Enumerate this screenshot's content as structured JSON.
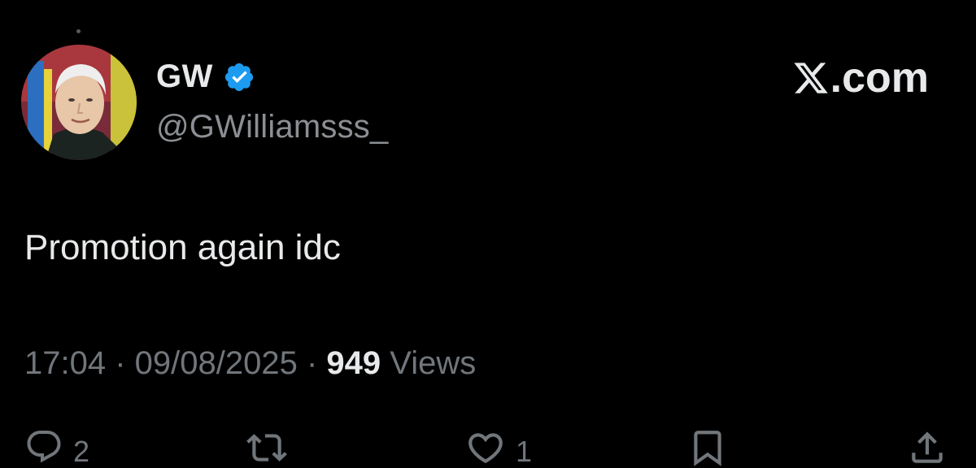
{
  "tweet": {
    "display_name": "GW",
    "handle": "@GWilliamsss_",
    "text": "Promotion again idc",
    "time": "17:04",
    "date": "09/08/2025",
    "separator": " · ",
    "views_count": "949",
    "views_label": "Views"
  },
  "brand": {
    "suffix": ".com"
  },
  "actions": {
    "replies": "2",
    "likes": "1"
  },
  "icons": {
    "verified": "verified-badge-icon",
    "reply": "reply-icon",
    "repost": "repost-icon",
    "like": "heart-icon",
    "bookmark": "bookmark-icon",
    "share": "share-icon"
  },
  "colors": {
    "background": "#000000",
    "text": "#e7e9ea",
    "muted": "#71767b",
    "verified_blue": "#1d9bf0"
  }
}
